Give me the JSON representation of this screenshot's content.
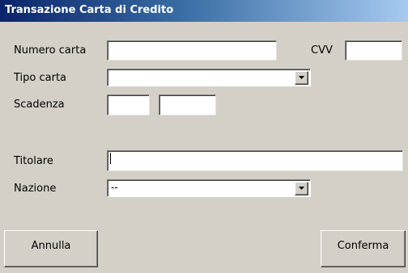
{
  "window": {
    "title": "Transazione Carta di Credito"
  },
  "form": {
    "card_number": {
      "label": "Numero carta",
      "value": ""
    },
    "cvv": {
      "label": "CVV",
      "value": ""
    },
    "card_type": {
      "label": "Tipo carta",
      "value": ""
    },
    "expiry": {
      "label": "Scadenza",
      "month": "",
      "year": ""
    },
    "holder": {
      "label": "Titolare",
      "value": ""
    },
    "country": {
      "label": "Nazione",
      "value": "--"
    }
  },
  "buttons": {
    "cancel": "Annulla",
    "confirm": "Conferma"
  },
  "colors": {
    "dialog_background": "#d4d0c8",
    "titlebar_start": "#0a246a",
    "titlebar_end": "#a6caf0",
    "title_text": "#ffffff"
  },
  "icons": {
    "dropdown": "chevron-down-icon"
  }
}
